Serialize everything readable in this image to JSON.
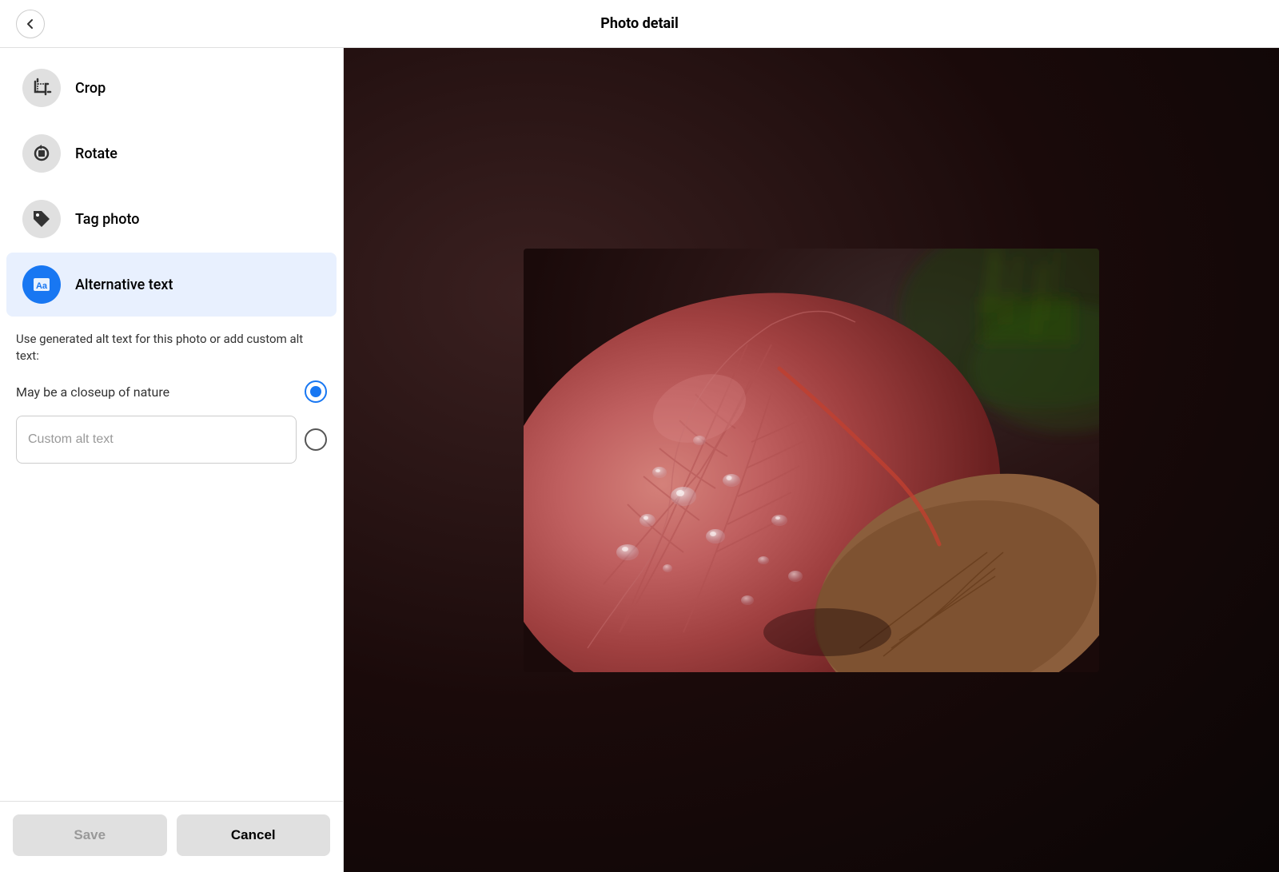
{
  "header": {
    "title": "Photo detail",
    "back_label": "back"
  },
  "menu": {
    "items": [
      {
        "id": "crop",
        "label": "Crop",
        "icon": "crop-icon",
        "active": false
      },
      {
        "id": "rotate",
        "label": "Rotate",
        "icon": "rotate-icon",
        "active": false
      },
      {
        "id": "tag",
        "label": "Tag photo",
        "icon": "tag-icon",
        "active": false
      },
      {
        "id": "alt-text",
        "label": "Alternative text",
        "icon": "alt-text-icon",
        "active": true
      }
    ]
  },
  "alt_text": {
    "description": "Use generated alt text for this photo or add custom alt text:",
    "generated_option": "May be a closeup of nature",
    "custom_placeholder": "Custom alt text",
    "selected": "generated"
  },
  "footer": {
    "save_label": "Save",
    "cancel_label": "Cancel"
  }
}
